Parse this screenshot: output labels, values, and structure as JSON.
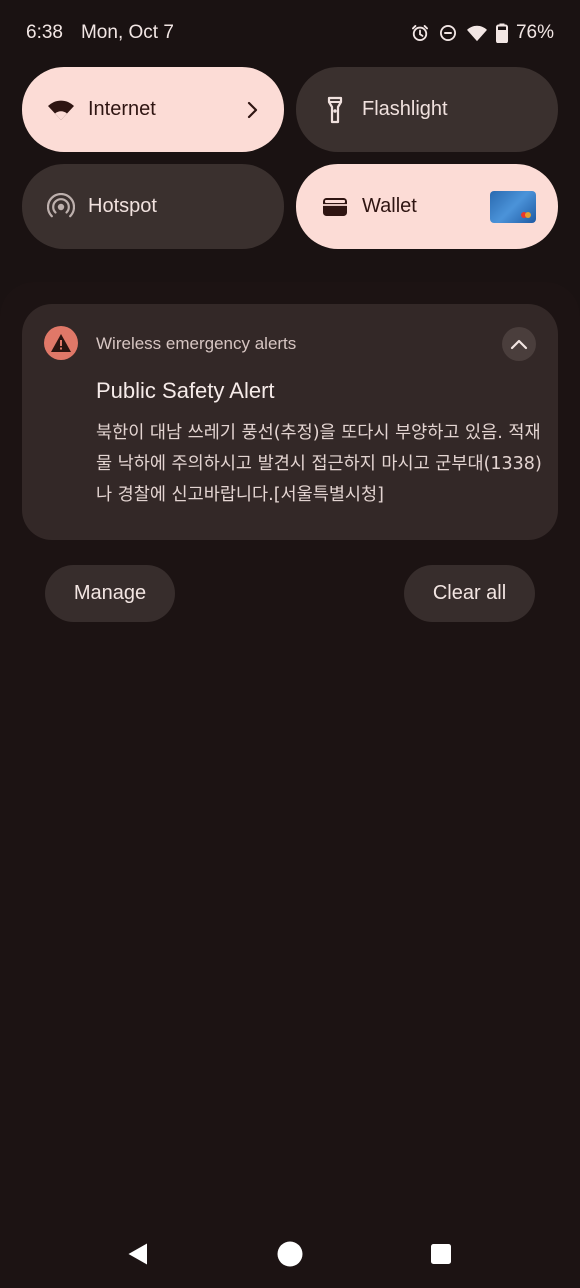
{
  "status_bar": {
    "time": "6:38",
    "date": "Mon, Oct 7",
    "battery": "76%",
    "icons": [
      "alarm-icon",
      "dnd-icon",
      "wifi-icon",
      "battery-icon"
    ]
  },
  "quick_settings": {
    "tiles": [
      {
        "label": "Internet",
        "state": "on",
        "icon": "wifi-icon",
        "has_chevron": true
      },
      {
        "label": "Flashlight",
        "state": "off",
        "icon": "flashlight-icon"
      },
      {
        "label": "Hotspot",
        "state": "off",
        "icon": "hotspot-icon"
      },
      {
        "label": "Wallet",
        "state": "on",
        "icon": "wallet-icon",
        "has_card": true
      }
    ]
  },
  "notification": {
    "app_name": "Wireless emergency alerts",
    "title": "Public Safety Alert",
    "body": "북한이 대남 쓰레기 풍선(추정)을 또다시 부양하고 있음. 적재물 낙하에 주의하시고 발견시 접근하지 마시고 군부대(1338)나 경찰에 신고바랍니다.[서울특별시청]",
    "icon": "warning-icon",
    "expand_icon": "chevron-up-icon"
  },
  "actions": {
    "manage": "Manage",
    "clear_all": "Clear all"
  },
  "colors": {
    "background": "#1a1212",
    "tile_on": "#fcdcd6",
    "tile_off": "#3a302e",
    "notification_bg": "#332827",
    "alert_icon": "#e07868"
  }
}
